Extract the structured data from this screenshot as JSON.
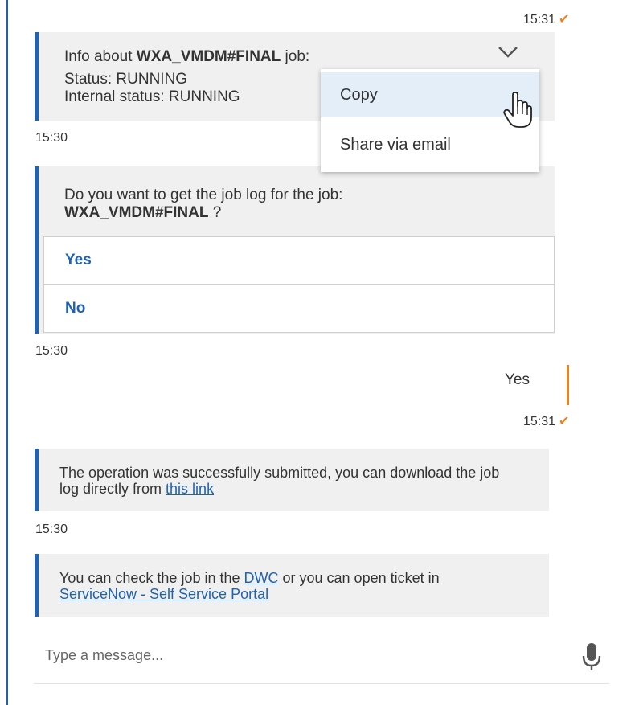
{
  "messages": [
    {
      "time": "15:31",
      "check": "✔"
    },
    {
      "info": {
        "prefix": "Info about ",
        "job": "WXA_VMDM#FINAL",
        "suffix": " job:",
        "status": "Status: RUNNING",
        "internal": "Internal status: RUNNING"
      }
    },
    {
      "time": "15:30"
    },
    {
      "question": {
        "line1": "Do you want to get the job log for the job:",
        "job": "WXA_VMDM#FINAL",
        "suffix": " ?"
      },
      "options": [
        "Yes",
        "No"
      ]
    },
    {
      "time": "15:30"
    },
    {
      "user_reply": "Yes",
      "time": "15:31",
      "check": "✔"
    },
    {
      "success": {
        "text": "The operation was successfully submitted, you can download the job log directly from ",
        "link": "this link"
      }
    },
    {
      "time": "15:30"
    },
    {
      "dwc": {
        "pre": "You can check the job in the ",
        "link1": "DWC",
        "mid": " or you can open ticket in",
        "link2": "ServiceNow - Self Service Portal"
      }
    }
  ],
  "context_menu": {
    "items": [
      "Copy",
      "Share via email"
    ],
    "hovered": "Copy"
  },
  "input": {
    "placeholder": "Type a message..."
  },
  "colors": {
    "accent_blue": "#1f62b4",
    "accent_orange": "#f0821e",
    "bubble_bg": "#f0f0f0"
  },
  "icons": [
    "chevron-down-icon",
    "hand-cursor-icon",
    "microphone-icon",
    "checkmark-icon"
  ]
}
